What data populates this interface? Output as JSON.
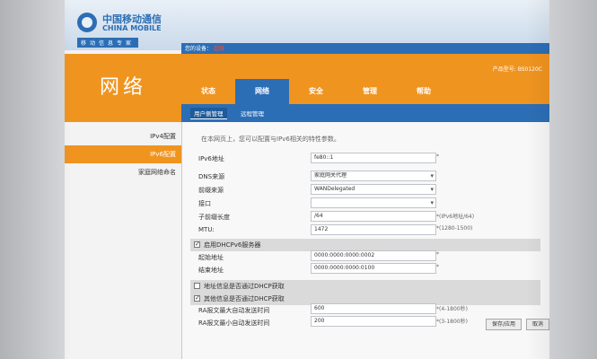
{
  "header": {
    "logo_cn": "中国移动通信",
    "logo_en": "CHINA MOBILE",
    "slogan": "移动信息专家",
    "device_label": "您的设备：",
    "device_name": "超级",
    "brand": "网络",
    "device_info": "产品型号: BS0120C"
  },
  "tabs": [
    {
      "label": "状态",
      "active": false
    },
    {
      "label": "网络",
      "active": true
    },
    {
      "label": "安全",
      "active": false
    },
    {
      "label": "管理",
      "active": false
    },
    {
      "label": "帮助",
      "active": false
    }
  ],
  "subtabs": [
    {
      "label": "用户侧管理",
      "active": true
    },
    {
      "label": "远程管理",
      "active": false
    }
  ],
  "sidebar": [
    {
      "label": "IPv4配置",
      "active": false
    },
    {
      "label": "IPv6配置",
      "active": true
    },
    {
      "label": "家庭网络命名",
      "active": false
    }
  ],
  "content": {
    "intro": "在本网页上，您可以配置与IPv6相关的特性参数。",
    "ipv6_addr_label": "IPv6地址",
    "ipv6_addr_value": "fe80::1",
    "dns_source_label": "DNS来源",
    "dns_source_value": "家庭网关代理",
    "prefix_source_label": "前缀来源",
    "prefix_source_value": "WANDelegated",
    "interface_label": "接口",
    "interface_value": "",
    "prefix_length_label": "子前缀长度",
    "prefix_length_value": "/64",
    "prefix_length_hint": "*(IPv6地址/64)",
    "mtu_label": "MTU:",
    "mtu_value": "1472",
    "mtu_hint": "*(1280-1500)",
    "dhcp_server_label": "启用DHCPv6服务器",
    "start_label": "起始地址",
    "start_value": "0000:0000:0000:0002",
    "end_label": "结束地址",
    "end_value": "0000:0000:0000:0100",
    "addr_via_dhcp_label": "地址信息是否通过DHCP获取",
    "other_via_dhcp_label": "其他信息是否通过DHCP获取",
    "ra_max_label": "RA报文最大自动发送时间",
    "ra_max_value": "600",
    "ra_max_hint": "*(4-1800秒)",
    "ra_min_label": "RA报文最小自动发送时间",
    "ra_min_value": "200",
    "ra_min_hint": "*(3-1800秒)",
    "save_label": "保存/应用",
    "cancel_label": "取消"
  },
  "colors": {
    "orange": "#f09420",
    "blue": "#2c6eb5"
  }
}
